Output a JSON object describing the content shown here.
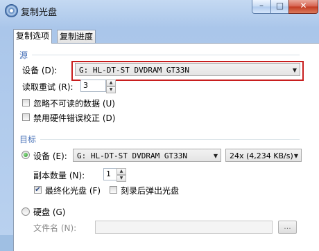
{
  "window": {
    "title": "复制光盘",
    "minimize_symbol": "–",
    "maximize_symbol": "□",
    "close_symbol": "✕"
  },
  "tabs": [
    "复制选项",
    "复制进度"
  ],
  "source": {
    "section_label": "源",
    "device_label": "设备 (D):",
    "device_value": "G: HL-DT-ST DVDRAM GT33N",
    "retry_label": "读取重试 (R):",
    "retry_value": "3",
    "ignore_unreadable_label": "忽略不可读的数据 (U)",
    "disable_hw_ecc_label": "禁用硬件错误校正 (D)"
  },
  "target": {
    "section_label": "目标",
    "device_label": "设备 (E):",
    "device_value": "G: HL-DT-ST DVDRAM GT33N",
    "speed_value": "24x (4,234 KB/s)",
    "copies_label": "副本数量 (N):",
    "copies_value": "1",
    "finalize_label": "最终化光盘 (F)",
    "finalize_checked": true,
    "eject_label": "刻录后弹出光盘",
    "eject_checked": false,
    "harddisk_label": "硬盘 (G)",
    "filename_label": "文件名 (N):",
    "filename_value": "",
    "browse_label": "..."
  },
  "icons": {
    "dropdown_arrow": "▼",
    "spin_up": "▲",
    "spin_down": "▼",
    "checkmark": "✔"
  }
}
